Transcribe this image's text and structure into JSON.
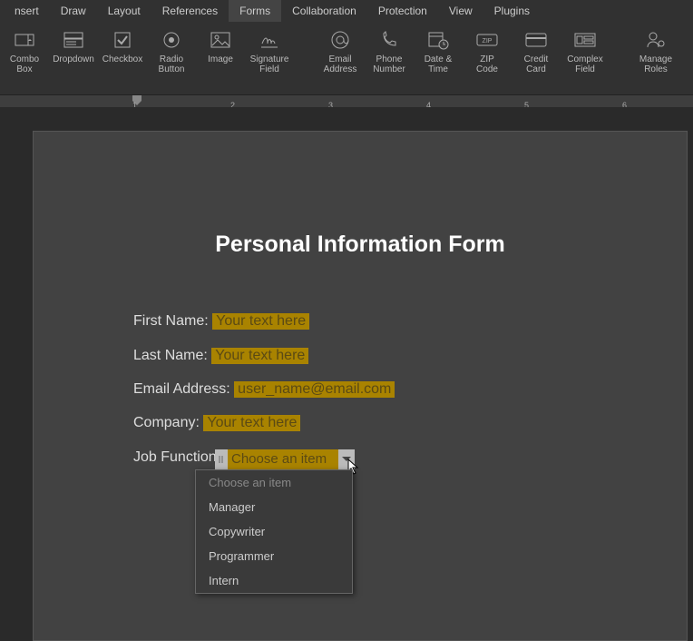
{
  "menu": [
    "nsert",
    "Draw",
    "Layout",
    "References",
    "Forms",
    "Collaboration",
    "Protection",
    "View",
    "Plugins"
  ],
  "menu_active_index": 4,
  "toolbar_left": [
    {
      "icon": "combo",
      "l1": "Combo",
      "l2": "Box"
    },
    {
      "icon": "dropdown",
      "l1": "Dropdown",
      "l2": ""
    },
    {
      "icon": "checkbox",
      "l1": "Checkbox",
      "l2": ""
    },
    {
      "icon": "radio",
      "l1": "Radio",
      "l2": "Button"
    },
    {
      "icon": "image",
      "l1": "Image",
      "l2": ""
    },
    {
      "icon": "signature",
      "l1": "Signature",
      "l2": "Field"
    }
  ],
  "toolbar_right": [
    {
      "icon": "email",
      "l1": "Email",
      "l2": "Address"
    },
    {
      "icon": "phone",
      "l1": "Phone",
      "l2": "Number"
    },
    {
      "icon": "datetime",
      "l1": "Date &",
      "l2": "Time"
    },
    {
      "icon": "zip",
      "l1": "ZIP",
      "l2": "Code"
    },
    {
      "icon": "credit",
      "l1": "Credit",
      "l2": "Card"
    },
    {
      "icon": "complex",
      "l1": "Complex",
      "l2": "Field"
    }
  ],
  "toolbar_far": [
    {
      "icon": "roles",
      "l1": "Manage",
      "l2": "Roles"
    }
  ],
  "ruler_numbers": [
    "1",
    "2",
    "3",
    "4",
    "5",
    "6"
  ],
  "doc": {
    "title": "Personal Information Form",
    "fields": {
      "first_name": {
        "label": "First Name:",
        "value": "Your text here"
      },
      "last_name": {
        "label": "Last Name:",
        "value": "Your text here"
      },
      "email": {
        "label": "Email Address:",
        "value": "user_name@email.com"
      },
      "company": {
        "label": "Company:",
        "value": "Your text here"
      },
      "job": {
        "label": "Job Function:",
        "value": "Choose an item"
      }
    }
  },
  "dropdown_options": [
    "Choose an item",
    "Manager",
    "Copywriter",
    "Programmer",
    "Intern"
  ]
}
